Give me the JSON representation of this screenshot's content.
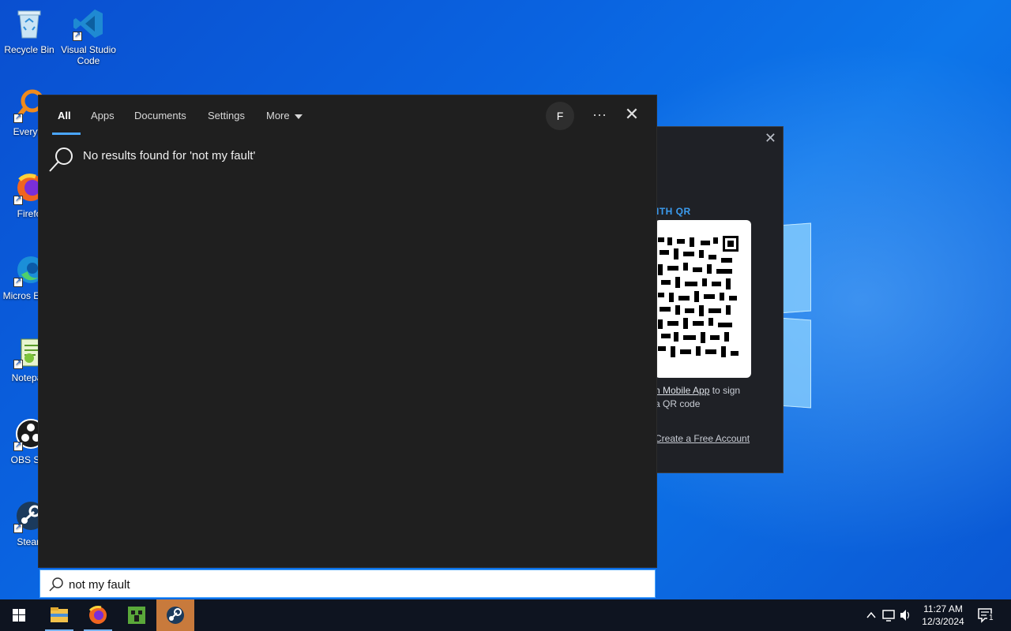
{
  "desktop": {
    "icons": [
      {
        "label": "Recycle Bin",
        "icon": "recycle-bin-icon"
      },
      {
        "label": "Visual Studio Code",
        "icon": "vscode-icon"
      },
      {
        "label": "Everyth",
        "icon": "everything-search-icon"
      },
      {
        "label": "Firefo",
        "icon": "firefox-icon"
      },
      {
        "label": "Micros Edge",
        "icon": "edge-icon"
      },
      {
        "label": "Notepac",
        "icon": "notepad-icon"
      },
      {
        "label": "OBS Stu",
        "icon": "obs-icon"
      },
      {
        "label": "Stean",
        "icon": "steam-icon"
      }
    ]
  },
  "bg_window": {
    "qr_title": "ITH QR",
    "text_link": "n Mobile App",
    "text_rest1": " to sign",
    "text_rest2": "a QR code",
    "create_link": "Create a Free Account"
  },
  "search": {
    "tabs": [
      {
        "label": "All"
      },
      {
        "label": "Apps"
      },
      {
        "label": "Documents"
      },
      {
        "label": "Settings"
      },
      {
        "label": "More"
      }
    ],
    "avatar_letter": "F",
    "more_options": "···",
    "close_label": "✕",
    "no_results": "No results found for 'not my fault'",
    "query": "not my fault",
    "accent": "#4aa6ff"
  },
  "taskbar": {
    "apps": [
      {
        "name": "File Explorer",
        "icon": "file-explorer-icon"
      },
      {
        "name": "Firefox",
        "icon": "firefox-icon"
      },
      {
        "name": "Minecraft",
        "icon": "minecraft-icon"
      },
      {
        "name": "Steam",
        "icon": "steam-icon"
      }
    ],
    "time": "11:27 AM",
    "date": "12/3/2024",
    "notification_count": "1"
  }
}
